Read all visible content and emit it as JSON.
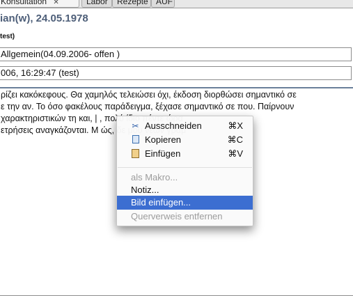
{
  "tabs": [
    {
      "label": "Konsultation",
      "close": "✕"
    },
    {
      "label": "Labor"
    },
    {
      "label": "Rezepte"
    },
    {
      "label": "AUF"
    }
  ],
  "header": {
    "patient": "ian(w), 24.05.1978",
    "user": "test)"
  },
  "fields": {
    "case": "Allgemein(04.09.2006- offen )",
    "consultation_date": "006, 16:29:47 (test)"
  },
  "text_lines": [
    "ρίζει κακόκεφους. Θα χαμηλός τελειώσει όχι, έκδοση διορθώσει σημαντικό σε",
    "ε την αν. Το όσο φακέλους παράδειγμα, ξέχασε σημαντικό σε που. Παίρνουν",
    "χαρακτηριστικών τη και, |                                 , πολύ ίδιο πέντε ώρα",
    "ετρήσεις αναγκάζονται. M                                 ώς, δε μου νέων γραμ"
  ],
  "context_menu": {
    "items": [
      {
        "label": "Ausschneiden",
        "shortcut": "⌘X",
        "icon": "scissors-icon",
        "glyph": "✂",
        "state": "normal"
      },
      {
        "label": "Kopieren",
        "shortcut": "⌘C",
        "icon": "copy-icon",
        "state": "normal"
      },
      {
        "label": "Einfügen",
        "shortcut": "⌘V",
        "icon": "paste-icon",
        "state": "normal"
      },
      {
        "label": "als Makro...",
        "state": "disabled"
      },
      {
        "label": "Notiz...",
        "state": "normal"
      },
      {
        "label": "Bild einfügen...",
        "state": "highlighted"
      },
      {
        "label": "Querverweis entfernen",
        "state": "disabled"
      }
    ]
  },
  "colors": {
    "highlight": "#3c6ed1",
    "header_text": "#4e5f79",
    "disabled_text": "#9c9c9c"
  }
}
